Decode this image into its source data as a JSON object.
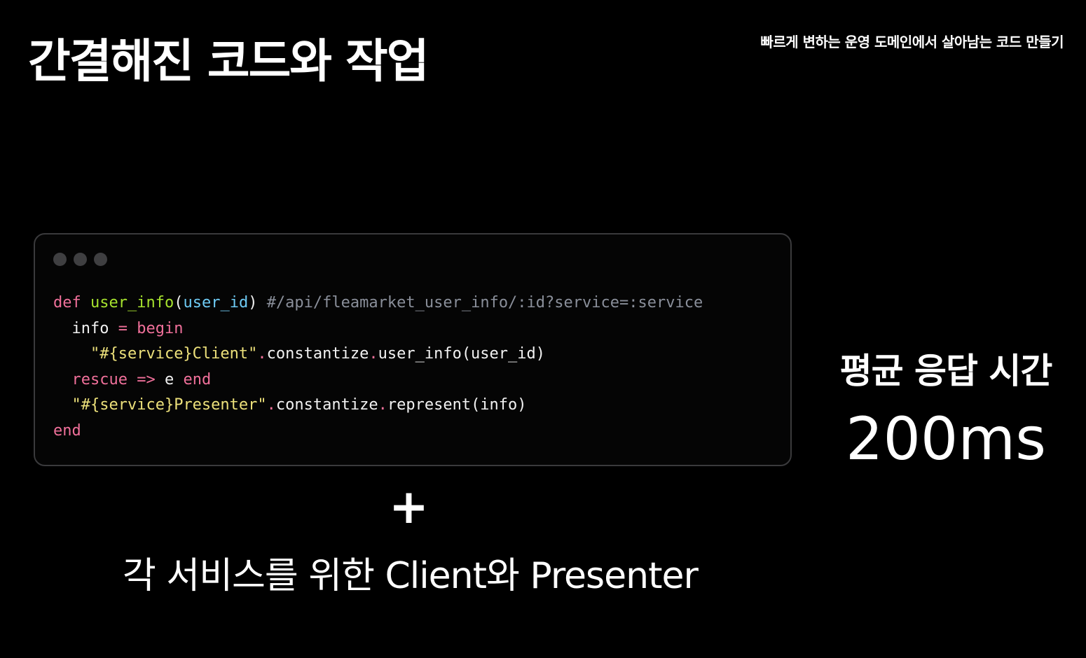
{
  "slide": {
    "title": "간결해진 코드와 작업",
    "subtitle": "빠르게 변하는 운영 도메인에서 살아남는 코드 만들기"
  },
  "code": {
    "lines": [
      [
        {
          "t": "def",
          "c": "kw"
        },
        {
          "t": " ",
          "c": "plain"
        },
        {
          "t": "user_info",
          "c": "fn"
        },
        {
          "t": "(",
          "c": "plain"
        },
        {
          "t": "user_id",
          "c": "arg"
        },
        {
          "t": ") ",
          "c": "plain"
        },
        {
          "t": "#/api/fleamarket_user_info/:id?service=:service",
          "c": "cm"
        }
      ],
      [
        {
          "t": "  info ",
          "c": "plain"
        },
        {
          "t": "=",
          "c": "op"
        },
        {
          "t": " ",
          "c": "plain"
        },
        {
          "t": "begin",
          "c": "kw"
        }
      ],
      [
        {
          "t": "    ",
          "c": "plain"
        },
        {
          "t": "\"#{service}Client\"",
          "c": "str"
        },
        {
          "t": ".",
          "c": "op"
        },
        {
          "t": "constantize",
          "c": "plain"
        },
        {
          "t": ".",
          "c": "op"
        },
        {
          "t": "user_info(user_id)",
          "c": "plain"
        }
      ],
      [
        {
          "t": "  ",
          "c": "plain"
        },
        {
          "t": "rescue",
          "c": "kw"
        },
        {
          "t": " ",
          "c": "plain"
        },
        {
          "t": "=>",
          "c": "op"
        },
        {
          "t": " e ",
          "c": "plain"
        },
        {
          "t": "end",
          "c": "kw"
        }
      ],
      [
        {
          "t": "  ",
          "c": "plain"
        },
        {
          "t": "\"#{service}Presenter\"",
          "c": "str"
        },
        {
          "t": ".",
          "c": "op"
        },
        {
          "t": "constantize",
          "c": "plain"
        },
        {
          "t": ".",
          "c": "op"
        },
        {
          "t": "represent(info)",
          "c": "plain"
        }
      ],
      [
        {
          "t": "end",
          "c": "kw"
        }
      ]
    ]
  },
  "plus_sign": "+",
  "caption": "각 서비스를 위한 Client와 Presenter",
  "metric": {
    "label": "평균 응답 시간",
    "value": "200ms"
  },
  "colors": {
    "background": "#000000",
    "keyword": "#f0709a",
    "function": "#a6e22e",
    "argument": "#6ecbf5",
    "comment": "#8a8f9a",
    "string": "#ece07a"
  }
}
